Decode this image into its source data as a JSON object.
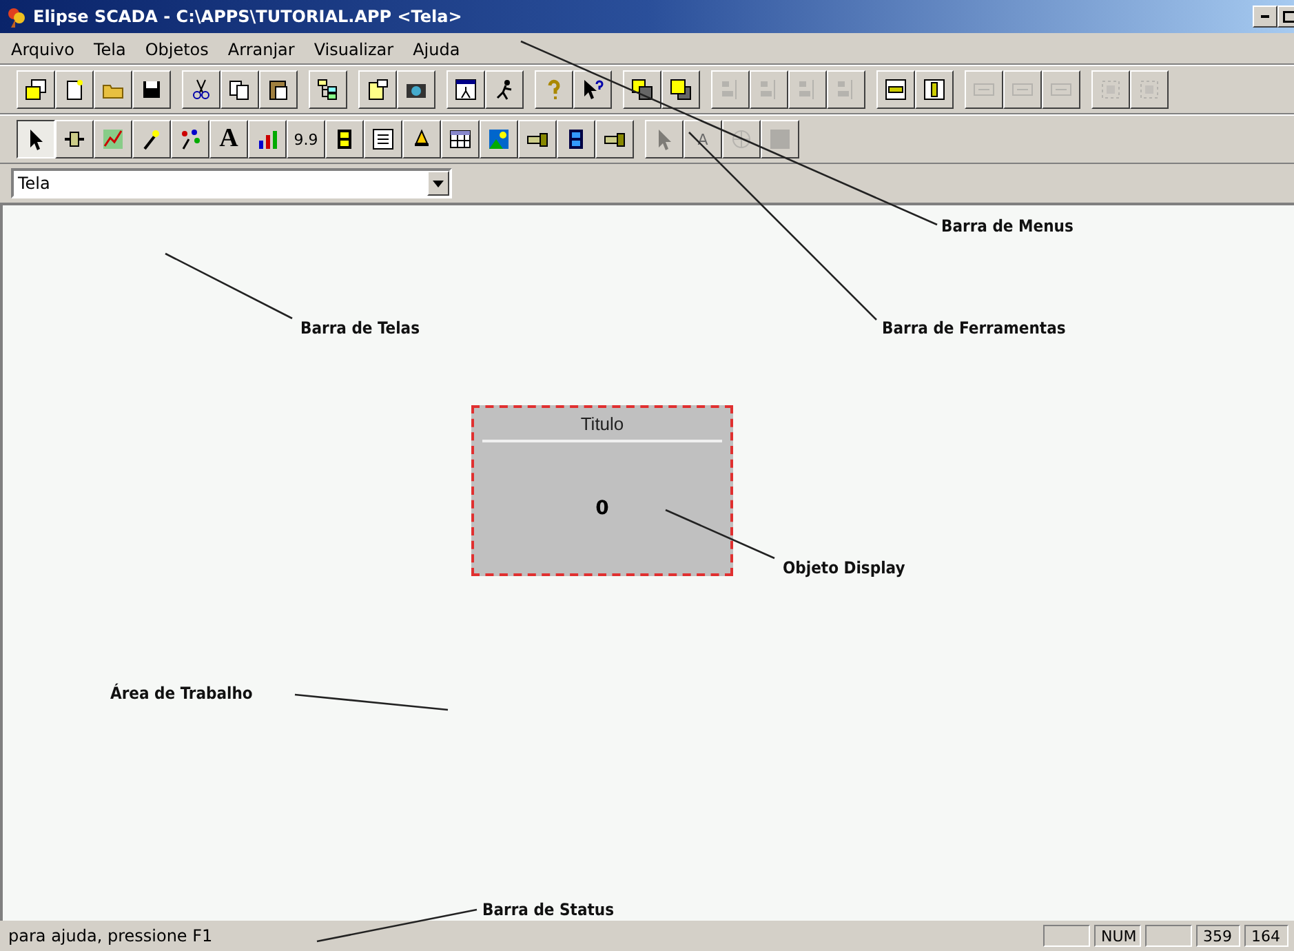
{
  "window": {
    "title": "Elipse SCADA - C:\\APPS\\TUTORIAL.APP <Tela>"
  },
  "menu": [
    "Arquivo",
    "Tela",
    "Objetos",
    "Arranjar",
    "Visualizar",
    "Ajuda"
  ],
  "toolbar_1": [
    [
      {
        "kind": "window",
        "disabled": false
      },
      {
        "kind": "page",
        "disabled": false
      },
      {
        "kind": "folder",
        "disabled": false
      },
      {
        "kind": "save",
        "disabled": false
      }
    ],
    [
      {
        "kind": "cut",
        "disabled": false
      },
      {
        "kind": "copy",
        "disabled": false
      },
      {
        "kind": "paste",
        "disabled": false
      }
    ],
    [
      {
        "kind": "tree",
        "disabled": false
      }
    ],
    [
      {
        "kind": "props",
        "disabled": false
      },
      {
        "kind": "camera",
        "disabled": false
      }
    ],
    [
      {
        "kind": "runwin",
        "disabled": false
      },
      {
        "kind": "runner",
        "disabled": false
      }
    ],
    [
      {
        "kind": "help",
        "disabled": false
      },
      {
        "kind": "pointerhelp",
        "disabled": false
      }
    ],
    [
      {
        "kind": "back",
        "disabled": false
      },
      {
        "kind": "front",
        "disabled": false
      }
    ],
    [
      {
        "kind": "align",
        "disabled": true
      },
      {
        "kind": "align",
        "disabled": true
      },
      {
        "kind": "align",
        "disabled": true
      },
      {
        "kind": "align",
        "disabled": true
      }
    ],
    [
      {
        "kind": "centerv",
        "disabled": false
      },
      {
        "kind": "centerh",
        "disabled": false
      }
    ],
    [
      {
        "kind": "space",
        "disabled": true
      },
      {
        "kind": "space",
        "disabled": true
      },
      {
        "kind": "space",
        "disabled": true
      }
    ],
    [
      {
        "kind": "gridalign",
        "disabled": true
      },
      {
        "kind": "gridalign",
        "disabled": true
      }
    ]
  ],
  "toolbar_2": [
    [
      {
        "kind": "pointer",
        "selected": true,
        "disabled": false
      },
      {
        "kind": "plug",
        "selected": false,
        "disabled": false
      },
      {
        "kind": "chart",
        "selected": false,
        "disabled": false
      },
      {
        "kind": "wand",
        "selected": false,
        "disabled": false
      },
      {
        "kind": "sparks",
        "selected": false,
        "disabled": false
      },
      {
        "kind": "text",
        "label": "A",
        "selected": false,
        "disabled": false
      },
      {
        "kind": "bars",
        "selected": false,
        "disabled": false
      },
      {
        "kind": "text",
        "label": "9.9",
        "selected": false,
        "disabled": false
      },
      {
        "kind": "film",
        "selected": false,
        "disabled": false
      },
      {
        "kind": "grid",
        "selected": false,
        "disabled": false
      },
      {
        "kind": "bell",
        "selected": false,
        "disabled": false
      },
      {
        "kind": "table",
        "selected": false,
        "disabled": false
      },
      {
        "kind": "image",
        "selected": false,
        "disabled": false
      },
      {
        "kind": "pipe",
        "selected": false,
        "disabled": false
      },
      {
        "kind": "filmblue",
        "selected": false,
        "disabled": false
      },
      {
        "kind": "pipe",
        "selected": false,
        "disabled": false
      }
    ],
    [
      {
        "kind": "pointer",
        "selected": false,
        "disabled": true
      },
      {
        "kind": "text",
        "label": "A",
        "selected": false,
        "disabled": true
      },
      {
        "kind": "globe",
        "selected": false,
        "disabled": true
      },
      {
        "kind": "square",
        "selected": false,
        "disabled": true
      }
    ]
  ],
  "screen_selector": {
    "value": "Tela"
  },
  "display_object": {
    "title": "Titulo",
    "value": "0"
  },
  "annotations": [
    {
      "text": "Barra de Menus"
    },
    {
      "text": "Barra de Telas"
    },
    {
      "text": "Barra de Ferramentas"
    },
    {
      "text": "Objeto Display"
    },
    {
      "text": "Área de Trabalho"
    },
    {
      "text": "Barra de Status"
    }
  ],
  "status_bar": {
    "message": "para ajuda, pressione F1",
    "panels": [
      {
        "kind": "empty"
      },
      {
        "kind": "text",
        "text": "NUM"
      },
      {
        "kind": "empty"
      },
      {
        "kind": "text",
        "text": "359"
      },
      {
        "kind": "text",
        "text": "164"
      }
    ]
  }
}
